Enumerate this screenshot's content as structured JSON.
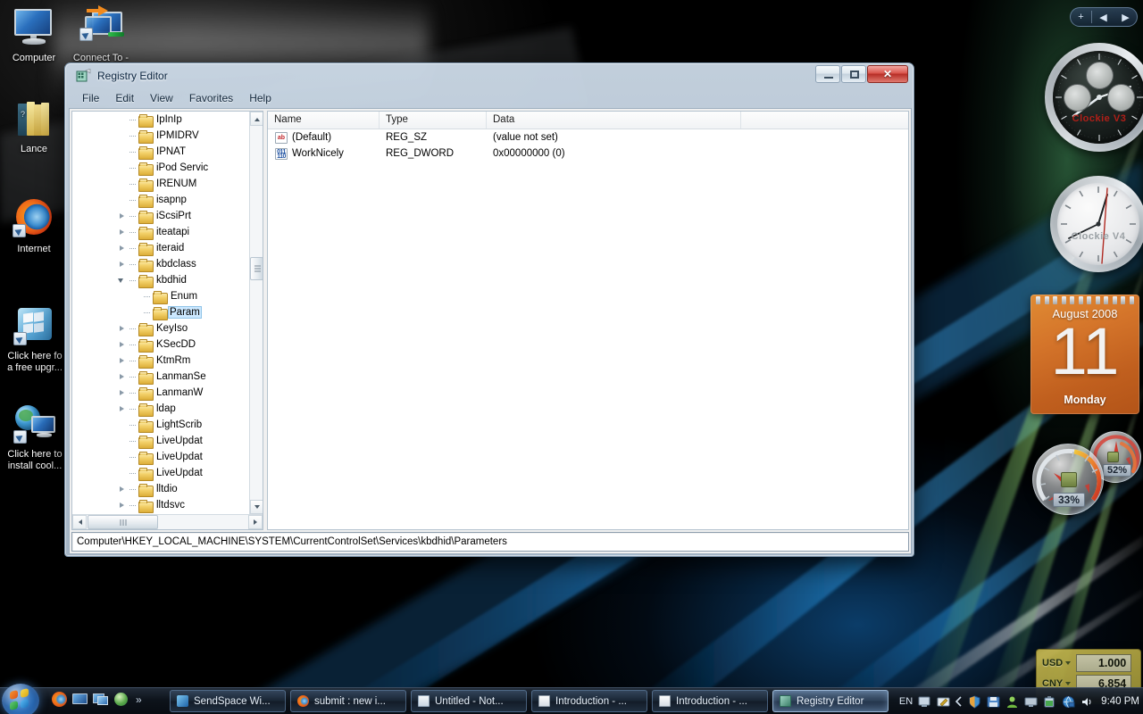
{
  "desktop": {
    "icons": [
      {
        "name": "computer",
        "label": "Computer",
        "icon": "computer-icon"
      },
      {
        "name": "connect-to",
        "label": "Connect To -",
        "icon": "network-connect-icon"
      },
      {
        "name": "lance",
        "label": "Lance",
        "icon": "folder-books-icon"
      },
      {
        "name": "internet",
        "label": "Internet",
        "icon": "firefox-icon"
      },
      {
        "name": "free-upgrade",
        "label": "Click here fo\na free upgr...",
        "icon": "windows-upgrade-icon"
      },
      {
        "name": "install-cool",
        "label": "Click here to\ninstall cool...",
        "icon": "globe-monitor-icon"
      }
    ]
  },
  "regedit": {
    "title": "Registry Editor",
    "icon": "regedit-icon",
    "window_buttons": {
      "minimize": "minimize-button",
      "maximize": "maximize-button",
      "close": "close-button",
      "close_glyph": "✕"
    },
    "menu": [
      "File",
      "Edit",
      "View",
      "Favorites",
      "Help"
    ],
    "tree": [
      {
        "label": "IpInIp",
        "indent": 3,
        "twisty": "none",
        "selected": false
      },
      {
        "label": "IPMIDRV",
        "indent": 3,
        "twisty": "none",
        "selected": false
      },
      {
        "label": "IPNAT",
        "indent": 3,
        "twisty": "none",
        "selected": false
      },
      {
        "label": "iPod Servic",
        "indent": 3,
        "twisty": "none",
        "selected": false
      },
      {
        "label": "IRENUM",
        "indent": 3,
        "twisty": "none",
        "selected": false
      },
      {
        "label": "isapnp",
        "indent": 3,
        "twisty": "none",
        "selected": false
      },
      {
        "label": "iScsiPrt",
        "indent": 3,
        "twisty": "closed",
        "selected": false
      },
      {
        "label": "iteatapi",
        "indent": 3,
        "twisty": "closed",
        "selected": false
      },
      {
        "label": "iteraid",
        "indent": 3,
        "twisty": "closed",
        "selected": false
      },
      {
        "label": "kbdclass",
        "indent": 3,
        "twisty": "closed",
        "selected": false
      },
      {
        "label": "kbdhid",
        "indent": 3,
        "twisty": "open",
        "selected": false
      },
      {
        "label": "Enum",
        "indent": 4,
        "twisty": "none",
        "selected": false
      },
      {
        "label": "Param",
        "indent": 4,
        "twisty": "none",
        "selected": true
      },
      {
        "label": "KeyIso",
        "indent": 3,
        "twisty": "closed",
        "selected": false
      },
      {
        "label": "KSecDD",
        "indent": 3,
        "twisty": "closed",
        "selected": false
      },
      {
        "label": "KtmRm",
        "indent": 3,
        "twisty": "closed",
        "selected": false
      },
      {
        "label": "LanmanSe",
        "indent": 3,
        "twisty": "closed",
        "selected": false
      },
      {
        "label": "LanmanW",
        "indent": 3,
        "twisty": "closed",
        "selected": false
      },
      {
        "label": "ldap",
        "indent": 3,
        "twisty": "closed",
        "selected": false
      },
      {
        "label": "LightScrib",
        "indent": 3,
        "twisty": "none",
        "selected": false
      },
      {
        "label": "LiveUpdat",
        "indent": 3,
        "twisty": "none",
        "selected": false
      },
      {
        "label": "LiveUpdat",
        "indent": 3,
        "twisty": "none",
        "selected": false
      },
      {
        "label": "LiveUpdat",
        "indent": 3,
        "twisty": "none",
        "selected": false
      },
      {
        "label": "lltdio",
        "indent": 3,
        "twisty": "closed",
        "selected": false
      },
      {
        "label": "lltdsvc",
        "indent": 3,
        "twisty": "closed",
        "selected": false
      }
    ],
    "list": {
      "columns": [
        "Name",
        "Type",
        "Data"
      ],
      "rows": [
        {
          "icon": "string-value-icon",
          "icon_text": "ab",
          "name": "(Default)",
          "type": "REG_SZ",
          "data": "(value not set)"
        },
        {
          "icon": "dword-value-icon",
          "icon_text": "011\n110",
          "name": "WorkNicely",
          "type": "REG_DWORD",
          "data": "0x00000000 (0)"
        }
      ]
    },
    "status": "Computer\\HKEY_LOCAL_MACHINE\\SYSTEM\\CurrentControlSet\\Services\\kbdhid\\Parameters"
  },
  "sidebar": {
    "header": {
      "add": "+",
      "prev": "◀",
      "next": "▶"
    },
    "clock_v3": {
      "brand": "Clockie V3",
      "brand_color": "#b01f18"
    },
    "clock_v4": {
      "brand": "Clockie V4",
      "brand_color": "#9aa0a4"
    },
    "calendar": {
      "month": "August 2008",
      "day": "11",
      "weekday": "Monday"
    },
    "cpu_meter": {
      "cpu_value": "33%",
      "memory_value": "52%"
    },
    "currency": {
      "rows": [
        {
          "code": "USD",
          "value": "1.000"
        },
        {
          "code": "CNY",
          "value": "6.854"
        }
      ]
    }
  },
  "taskbar": {
    "start": "start-orb",
    "quicklaunch": [
      {
        "name": "firefox",
        "icon": "firefox-icon"
      },
      {
        "name": "show-desktop",
        "icon": "show-desktop-icon"
      },
      {
        "name": "switch-windows",
        "icon": "switch-windows-icon"
      },
      {
        "name": "media",
        "icon": "media-icon"
      }
    ],
    "quicklaunch_overflow": "»",
    "tasks": [
      {
        "label": "SendSpace Wi...",
        "icon": "sendspace-icon",
        "active": false
      },
      {
        "label": "submit : new i...",
        "icon": "firefox-icon",
        "active": false
      },
      {
        "label": "Untitled - Not...",
        "icon": "notepad-icon",
        "active": false
      },
      {
        "label": "Introduction - ...",
        "icon": "document-icon",
        "active": false
      },
      {
        "label": "Introduction - ...",
        "icon": "document-icon",
        "active": false
      },
      {
        "label": "Registry Editor",
        "icon": "regedit-icon",
        "active": true
      }
    ],
    "tray": {
      "language": "EN",
      "icons": [
        {
          "name": "input-panel",
          "icon": "pen-tablet-icon"
        },
        {
          "name": "tray-expand",
          "icon": "chevron-left-icon"
        },
        {
          "name": "security",
          "icon": "shield-icon"
        },
        {
          "name": "update",
          "icon": "disk-icon"
        },
        {
          "name": "user",
          "icon": "person-icon"
        },
        {
          "name": "display",
          "icon": "monitor-icon"
        },
        {
          "name": "battery",
          "icon": "battery-icon"
        },
        {
          "name": "network",
          "icon": "network-icon"
        },
        {
          "name": "volume",
          "icon": "speaker-icon"
        }
      ],
      "clock": "9:40 PM"
    }
  }
}
